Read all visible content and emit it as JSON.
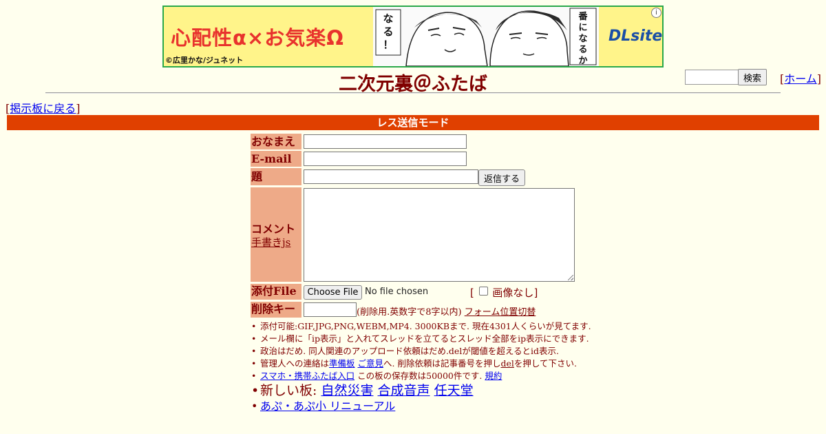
{
  "ad": {
    "tagline": "心配性α×お気楽Ω",
    "credit": "©広里かな/ジュネット",
    "logo": "DLsite",
    "info": "i",
    "bubble_left": "なる！",
    "bubble_right": "番になるか"
  },
  "header": {
    "title": "二次元裏＠ふたば",
    "search_button": "検索",
    "search_value": "",
    "home_open": "[",
    "home_label": "ホーム",
    "home_close": "]"
  },
  "back": {
    "open": "[",
    "label": "掲示板に戻る",
    "close": "]"
  },
  "mode_bar": "レス送信モード",
  "form": {
    "name_label": "おなまえ",
    "email_label": "E-mail",
    "subject_label": "題　名",
    "comment_label": "コメント",
    "handwriting_link": "手書きjs",
    "file_label": "添付File",
    "delkey_label": "削除キー",
    "submit_button": "返信する",
    "file_button": "Choose File",
    "file_status": "No file chosen",
    "noimg_open": "[",
    "noimg_label": "画像なし",
    "noimg_close": "]",
    "delkey_note": "(削除用.英数字で8字以内)",
    "form_toggle_link": "フォーム位置切替"
  },
  "notes": {
    "line1": "添付可能:GIF,JPG,PNG,WEBM,MP4. 3000KBまで. 現在4301人くらいが見てます.",
    "line2": "メール欄に「ip表示」と入れてスレッドを立てるとスレッド全部をip表示にできます.",
    "line3": "政治はだめ. 同人関連のアップロード依頼はだめ.delが閾値を超えるとid表示.",
    "line4_pre": "管理人への連絡は",
    "line4_link1": "準備板",
    "line4_link2": "ご意見",
    "line4_mid": "へ. 削除依頼は記事番号を押し",
    "line4_del": "del",
    "line4_post": "を押して下さい.",
    "line5_link": "スマホ・携帯ふたば入口",
    "line5_mid": " この板の保存数は50000件です. ",
    "line5_rules": "規約",
    "line6_prefix": "新しい板: ",
    "line6_links": [
      "自然災害",
      "合成音声",
      "任天堂"
    ],
    "line7_link": "あぷ・あぷ小 リニューアル"
  },
  "colors": {
    "background": "#ffffee",
    "text": "#800000",
    "mode_bar": "#e04000",
    "label_bg": "#eeaa88",
    "link": "#0000ee"
  }
}
